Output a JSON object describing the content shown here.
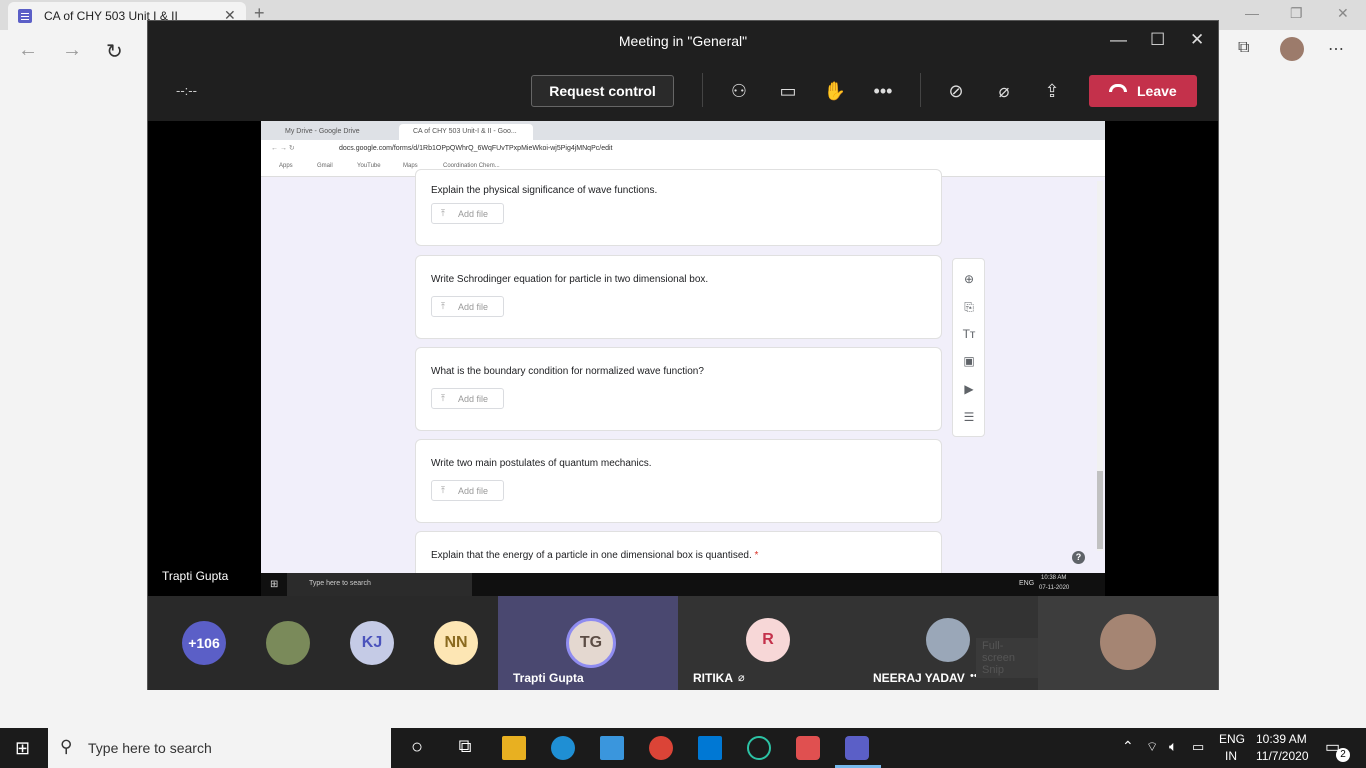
{
  "edge": {
    "tab_title": "CA of CHY 503 Unit I & II",
    "tab_close": "✕",
    "new_tab": "+"
  },
  "teams": {
    "window_title": "Meeting in \"General\"",
    "timer": "--:--",
    "request_control": "Request control",
    "leave": "Leave",
    "more": "•••"
  },
  "shared_browser": {
    "tab1": "My Drive - Google Drive",
    "tab2": "CA of CHY 503 Unit-I & II - Goo...",
    "url": "docs.google.com/forms/d/1Rb1OPpQWhrQ_6WqFUvTPxpMieWkoi-wj5Pig4jMNqPc/edit",
    "bookmarks": [
      "Apps",
      "Gmail",
      "YouTube",
      "Maps",
      "Coordination Chem..."
    ]
  },
  "form": {
    "add_file": "Add file",
    "questions": [
      {
        "text": "Explain the physical significance of wave functions.",
        "required": false
      },
      {
        "text": "Write Schrodinger equation for particle in two dimensional box.",
        "required": false
      },
      {
        "text": "What is the boundary condition for normalized wave function?",
        "required": false
      },
      {
        "text": "Write two main postulates of quantum mechanics.",
        "required": false
      },
      {
        "text": "Explain that the energy of a particle in one dimensional box is quantised.",
        "required": true
      }
    ],
    "required_mark": "*",
    "help": "?"
  },
  "inner_taskbar": {
    "search": "Type here to search",
    "lang": "ENG",
    "time": "10:38 AM",
    "date": "07-11-2020"
  },
  "presenter_label": "Trapti Gupta",
  "participants": {
    "overflow": "+106",
    "kj": "KJ",
    "nn": "NN",
    "tg_initials": "TG",
    "tg_name": "Trapti Gupta",
    "r_initials": "R",
    "r_name": "RITIKA",
    "neeraj_name": "NEERAJ YADAV",
    "snip_overlay": "Full-screen Snip"
  },
  "taskbar": {
    "search": "Type here to search",
    "lang1": "ENG",
    "lang2": "IN",
    "time": "10:39 AM",
    "date": "11/7/2020",
    "notif_count": "2"
  },
  "colors": {
    "leave": "#c4314b",
    "teams_accent": "#6264a7",
    "form_bg": "#f1effa"
  }
}
